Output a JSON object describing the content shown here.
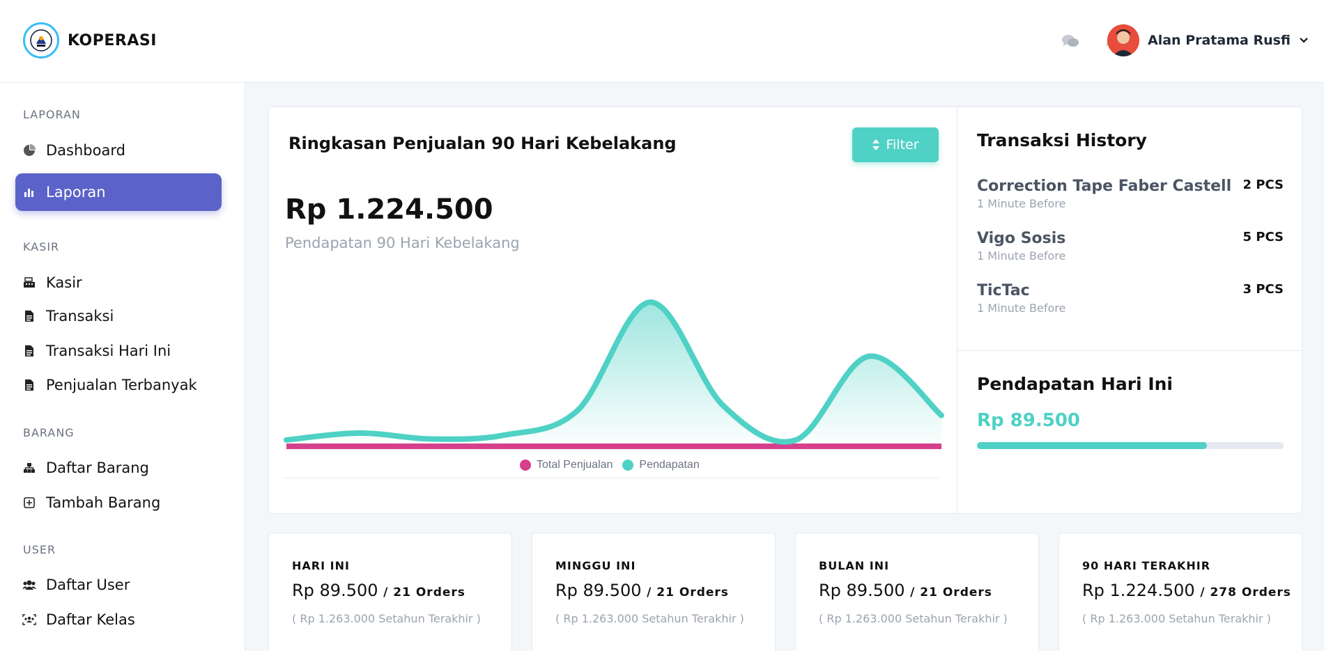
{
  "brand": {
    "name": "KOPERASI"
  },
  "header": {
    "icons": [
      "chat-icon",
      "bell-icon"
    ],
    "user_name": "Alan Pratama Rusfi"
  },
  "sidebar": {
    "sections": [
      {
        "label": "LAPORAN",
        "items": [
          {
            "label": "Dashboard",
            "icon": "pie-chart-icon",
            "active": false
          },
          {
            "label": "Laporan",
            "icon": "bar-chart-icon",
            "active": true
          }
        ]
      },
      {
        "label": "KASIR",
        "items": [
          {
            "label": "Kasir",
            "icon": "cash-register-icon"
          },
          {
            "label": "Transaksi",
            "icon": "file-icon"
          },
          {
            "label": "Transaksi Hari Ini",
            "icon": "file-icon"
          },
          {
            "label": "Penjualan Terbanyak",
            "icon": "file-icon"
          }
        ]
      },
      {
        "label": "BARANG",
        "items": [
          {
            "label": "Daftar Barang",
            "icon": "sitemap-icon"
          },
          {
            "label": "Tambah Barang",
            "icon": "plus-square-icon"
          }
        ]
      },
      {
        "label": "USER",
        "items": [
          {
            "label": "Daftar User",
            "icon": "users-icon"
          },
          {
            "label": "Daftar Kelas",
            "icon": "class-icon"
          }
        ]
      }
    ]
  },
  "summary": {
    "title": "Ringkasan Penjualan 90 Hari Kebelakang",
    "filter_label": "Filter",
    "total": "Rp 1.224.500",
    "total_sub": "Pendapatan 90 Hari Kebelakang"
  },
  "chart_data": {
    "type": "area",
    "x": [
      1,
      2,
      3,
      4,
      5,
      6,
      7,
      8,
      9,
      10
    ],
    "series": [
      {
        "name": "Total Penjualan",
        "color": "#d63f8c",
        "values": [
          0,
          0,
          0,
          0,
          0,
          0,
          0,
          0,
          0,
          0
        ]
      },
      {
        "name": "Pendapatan",
        "color": "#4fd1c5",
        "values": [
          5,
          12,
          6,
          10,
          35,
          145,
          40,
          5,
          90,
          30
        ]
      }
    ],
    "grid": false,
    "legend": "bottom"
  },
  "history": {
    "title": "Transaksi History",
    "items": [
      {
        "name": "Correction Tape Faber Castell",
        "time": "1 Minute Before",
        "qty": "2 PCS"
      },
      {
        "name": "Vigo Sosis",
        "time": "1 Minute Before",
        "qty": "5 PCS"
      },
      {
        "name": "TicTac",
        "time": "1 Minute Before",
        "qty": "3 PCS"
      }
    ]
  },
  "income_today": {
    "title": "Pendapatan Hari Ini",
    "value": "Rp 89.500",
    "progress": 0.75
  },
  "stats": [
    {
      "label": "HARI INI",
      "amount": "Rp 89.500",
      "orders": "/ 21 Orders",
      "sub": "( Rp 1.263.000 Setahun Terakhir )"
    },
    {
      "label": "MINGGU INI",
      "amount": "Rp 89.500",
      "orders": "/ 21 Orders",
      "sub": "( Rp 1.263.000 Setahun Terakhir )"
    },
    {
      "label": "BULAN INI",
      "amount": "Rp 89.500",
      "orders": "/ 21 Orders",
      "sub": "( Rp 1.263.000 Setahun Terakhir )"
    },
    {
      "label": "90 HARI TERAKHIR",
      "amount": "Rp 1.224.500",
      "orders": "/ 278 Orders",
      "sub": "( Rp 1.263.000 Setahun Terakhir )"
    }
  ]
}
